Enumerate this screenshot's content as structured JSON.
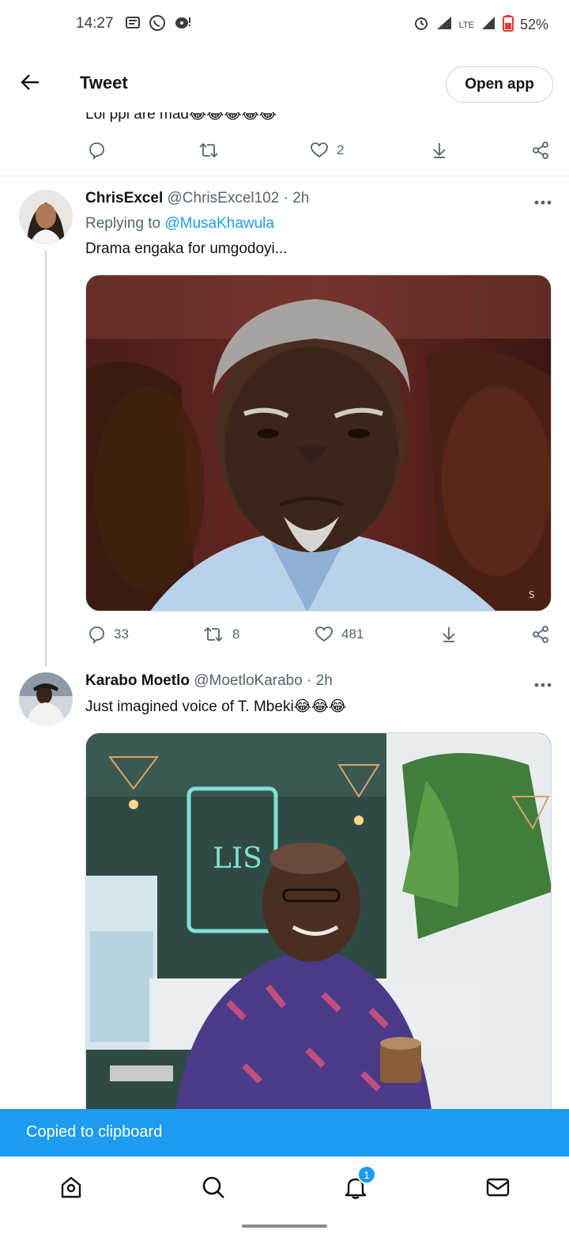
{
  "status_bar": {
    "time": "14:27",
    "battery": "52%",
    "network": "LTE",
    "left_icons": [
      "message-icon",
      "whatsapp-icon",
      "bubble-alert-icon"
    ],
    "right_icons": [
      "alarm-icon",
      "signal-icon",
      "battery-icon"
    ]
  },
  "header": {
    "title": "Tweet",
    "open_app_label": "Open app"
  },
  "partial_tweet": {
    "text": "Lol ppl are mad😂😂😂😂😂",
    "likes": "2"
  },
  "tweets": [
    {
      "name": "ChrisExcel",
      "handle": "@ChrisExcel102",
      "time": "· 2h",
      "reply_prefix": "Replying to ",
      "reply_mention": "@MusaKhawula",
      "text": "Drama engaka for umgodoyi...",
      "replies": "33",
      "retweets": "8",
      "likes": "481",
      "media_watermark": "S"
    },
    {
      "name": "Karabo Moetlo",
      "handle": "@MoetloKarabo",
      "time": "· 2h",
      "text": "Just imagined voice of T. Mbeki😂😂😂",
      "media_sign": "LIS"
    }
  ],
  "toast": {
    "message": "Copied to clipboard"
  },
  "bottom_nav": {
    "items": [
      "home-icon",
      "search-icon",
      "notifications-icon",
      "messages-icon"
    ],
    "notification_count": "1"
  },
  "colors": {
    "accent": "#1d9bf0",
    "text_primary": "#0f1419",
    "text_secondary": "#536471",
    "border": "#cfd9de"
  }
}
